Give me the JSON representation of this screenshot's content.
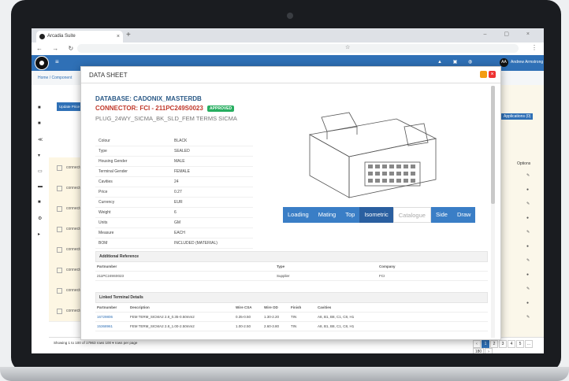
{
  "browser": {
    "tab_title": "Arcadia Suite",
    "tab_close": "×",
    "new_tab": "+",
    "window_controls": "– ▢ ×"
  },
  "app": {
    "user_initials": "AA",
    "user_name": "Andrew Armstrong",
    "breadcrumb": "Home / Component",
    "update_button": "Update Price",
    "applications_pill": "Applications (0)",
    "options_header": "Options",
    "showing_text": "Showing 1 to 100 of 17963 rows  100 ▾  rows per page",
    "pager": [
      "‹",
      "1",
      "2",
      "3",
      "4",
      "5",
      "...",
      "180",
      "›"
    ],
    "bg_rows": [
      "connector",
      "connector",
      "connector",
      "connector",
      "connector",
      "connector",
      "connector",
      "connector"
    ]
  },
  "modal": {
    "title": "DATA SHEET",
    "close_label": "×",
    "database_label": "DATABASE:",
    "database_value": "CADONIX_MASTERDB",
    "connector_label": "CONNECTOR:",
    "connector_value": "FCI - 211PC249S0023",
    "status_badge": "APPROVED",
    "description": "PLUG_24WY_SICMA_BK_SLD_FEM TERMS SICMA",
    "attributes": [
      {
        "key": "Colour",
        "value": "BLACK"
      },
      {
        "key": "Type",
        "value": "SEALED"
      },
      {
        "key": "Housing Gender",
        "value": "MALE"
      },
      {
        "key": "Terminal Gender",
        "value": "FEMALE"
      },
      {
        "key": "Cavities",
        "value": "24"
      },
      {
        "key": "Price",
        "value": "0.27"
      },
      {
        "key": "Currency",
        "value": "EUR"
      },
      {
        "key": "Weight",
        "value": "6"
      },
      {
        "key": "Units",
        "value": "GM"
      },
      {
        "key": "Measure",
        "value": "EACH"
      },
      {
        "key": "BOM",
        "value": "INCLUDED (MATERIAL)"
      }
    ],
    "view_tabs": [
      {
        "label": "Loading",
        "style": "normal"
      },
      {
        "label": "Mating",
        "style": "normal"
      },
      {
        "label": "Top",
        "style": "normal"
      },
      {
        "label": "Isometric",
        "style": "active"
      },
      {
        "label": "Catalogue",
        "style": "light"
      },
      {
        "label": "Side",
        "style": "normal"
      },
      {
        "label": "Draw",
        "style": "normal"
      }
    ],
    "additional_reference": {
      "title": "Additional Reference",
      "headers": {
        "partnumber": "Partnumber",
        "type": "Type",
        "company": "Company"
      },
      "rows": [
        {
          "partnumber": "211PC249S0023",
          "type": "Supplier",
          "company": "FCI"
        }
      ]
    },
    "linked_terminals": {
      "title": "Linked Terminal Details",
      "headers": {
        "partnumber": "Partnumber",
        "description": "Description",
        "wire_csa": "Wire CSA",
        "wire_od": "Wire OD",
        "finish": "Finish",
        "cavities": "Cavities"
      },
      "rows": [
        {
          "partnumber": "16729806",
          "description": "FEM TERM_SICMA2 2.8_0.35-0.50mm2",
          "wire_csa": "0.35-0.50",
          "wire_od": "1.30-2.20",
          "finish": "TIN",
          "cavities": "A8, B1, B8, C1, C8, H1"
        },
        {
          "partnumber": "15368961",
          "description": "FEM TERM_SICMA2 2.8_1.00-2.50mm2",
          "wire_csa": "1.00-2.50",
          "wire_od": "2.60-3.80",
          "finish": "TIN",
          "cavities": "A8, B1, B8, C1, C8, H1"
        }
      ]
    }
  }
}
